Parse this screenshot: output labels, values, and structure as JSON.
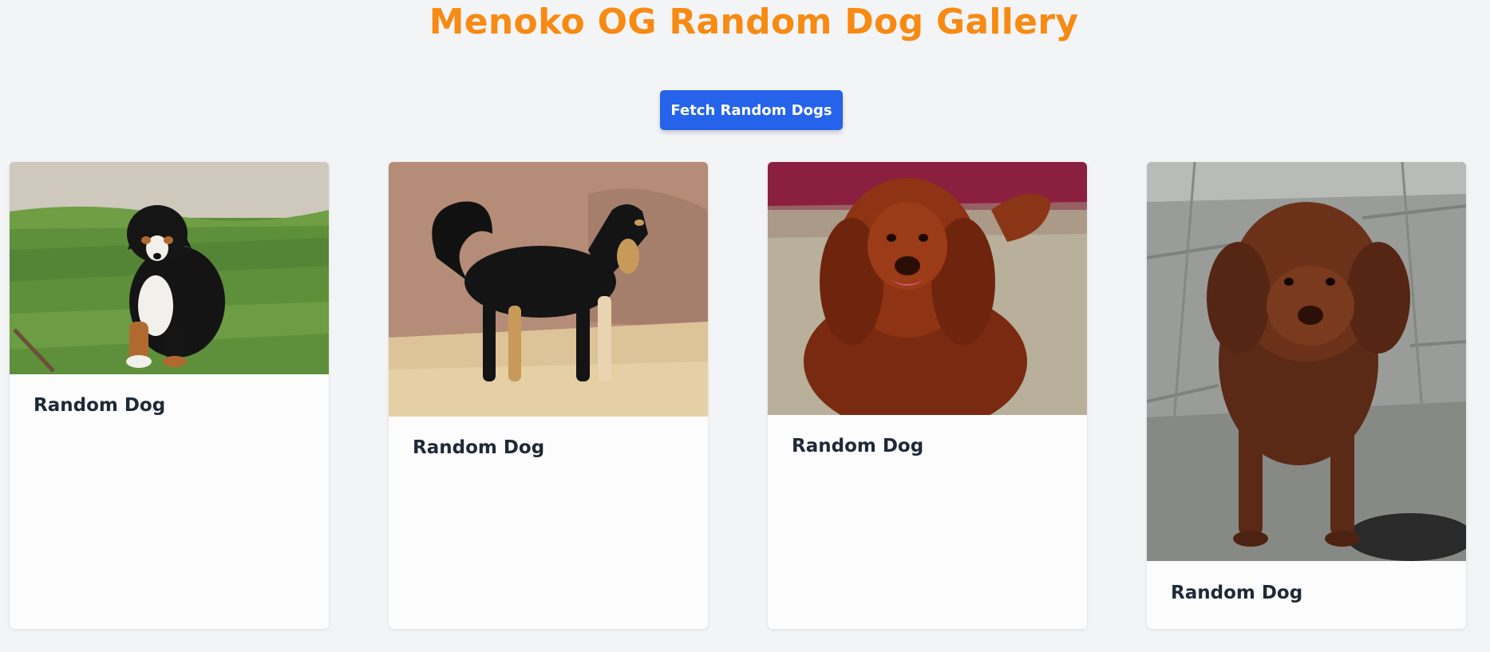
{
  "page": {
    "title": "Menoko OG Random Dog Gallery"
  },
  "colors": {
    "title": "#f78a12",
    "button": "#2563eb",
    "background": "#f3f4f6",
    "card": "#fcfcfd",
    "text": "#1f2937"
  },
  "toolbar": {
    "fetch_label": "Fetch Random Dogs"
  },
  "gallery": {
    "cards": [
      {
        "label": "Random Dog",
        "image_alt": "Black, white and tan puppy sitting on grass"
      },
      {
        "label": "Random Dog",
        "image_alt": "Black and tan long-haired dog standing on dry ground"
      },
      {
        "label": "Random Dog",
        "image_alt": "Reddish-brown long-eared spaniel walking toward camera"
      },
      {
        "label": "Random Dog",
        "image_alt": "Brown curly-coated dog standing on wet stone patio"
      }
    ]
  }
}
